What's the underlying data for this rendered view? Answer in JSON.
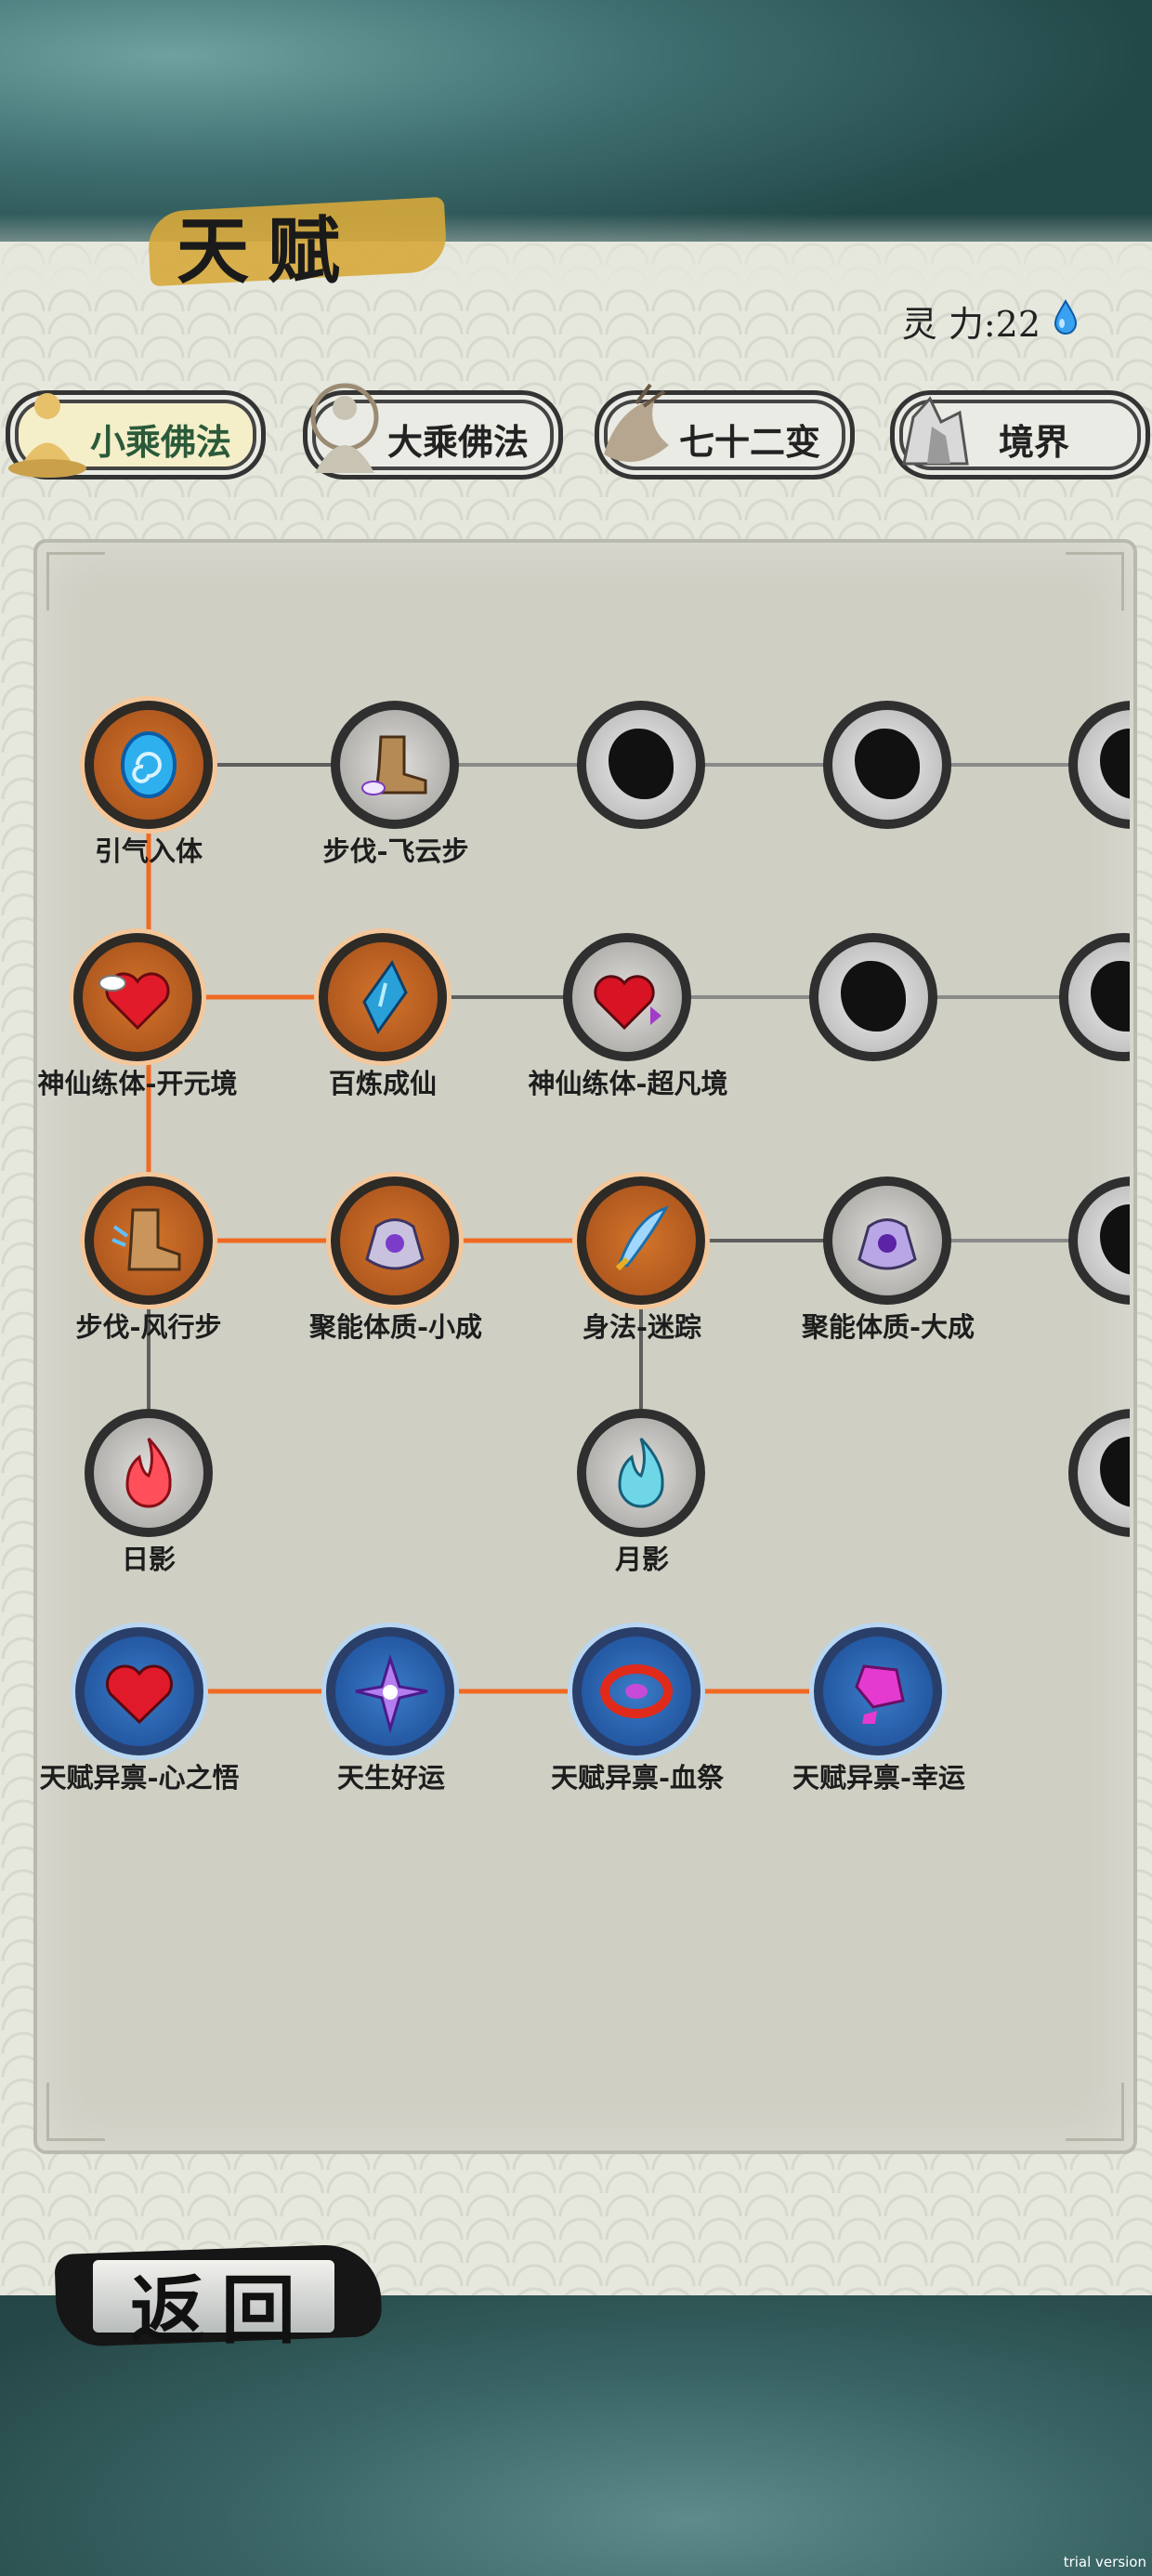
{
  "header": {
    "title": "天赋",
    "spirit_label": "灵 力:",
    "spirit_value": "22"
  },
  "tabs": [
    {
      "label": "小乘佛法",
      "active": true,
      "icon": "meditating-monk-icon"
    },
    {
      "label": "大乘佛法",
      "active": false,
      "icon": "buddha-icon"
    },
    {
      "label": "七十二变",
      "active": false,
      "icon": "monkey-king-icon"
    },
    {
      "label": "境界",
      "active": false,
      "icon": "crystal-rock-icon"
    }
  ],
  "talents": {
    "n1": {
      "label": "引气入体",
      "state": "learned",
      "icon": "spiral-orb-icon"
    },
    "n2": {
      "label": "步伐-飞云步",
      "state": "available",
      "icon": "cloud-boot-icon"
    },
    "n3": {
      "label": "神仙练体-开元境",
      "state": "learned",
      "icon": "winged-heart-icon"
    },
    "n4": {
      "label": "百炼成仙",
      "state": "learned",
      "icon": "blue-crystal-icon"
    },
    "n5": {
      "label": "神仙练体-超凡境",
      "state": "available",
      "icon": "heart-potion-icon"
    },
    "n6": {
      "label": "步伐-风行步",
      "state": "learned",
      "icon": "wind-boot-icon"
    },
    "n7": {
      "label": "聚能体质-小成",
      "state": "learned",
      "icon": "pouch-icon"
    },
    "n8": {
      "label": "身法-迷踪",
      "state": "learned",
      "icon": "feather-icon"
    },
    "n9": {
      "label": "聚能体质-大成",
      "state": "available",
      "icon": "purple-pouch-icon"
    },
    "n10": {
      "label": "日影",
      "state": "available",
      "icon": "red-flame-icon"
    },
    "n11": {
      "label": "月影",
      "state": "available",
      "icon": "blue-flame-icon"
    },
    "n12": {
      "label": "天赋异禀-心之悟",
      "state": "blue",
      "icon": "red-heart-icon"
    },
    "n13": {
      "label": "天生好运",
      "state": "blue",
      "icon": "purple-flower-icon"
    },
    "n14": {
      "label": "天赋异禀-血祭",
      "state": "blue",
      "icon": "ruby-ring-icon"
    },
    "n15": {
      "label": "天赋异禀-幸运",
      "state": "blue",
      "icon": "pink-gem-icon"
    }
  },
  "colors": {
    "active_link": "#f06a22",
    "inactive_link": "#6b6b6b"
  },
  "back_button": {
    "label": "返回"
  },
  "watermark": "trial version"
}
